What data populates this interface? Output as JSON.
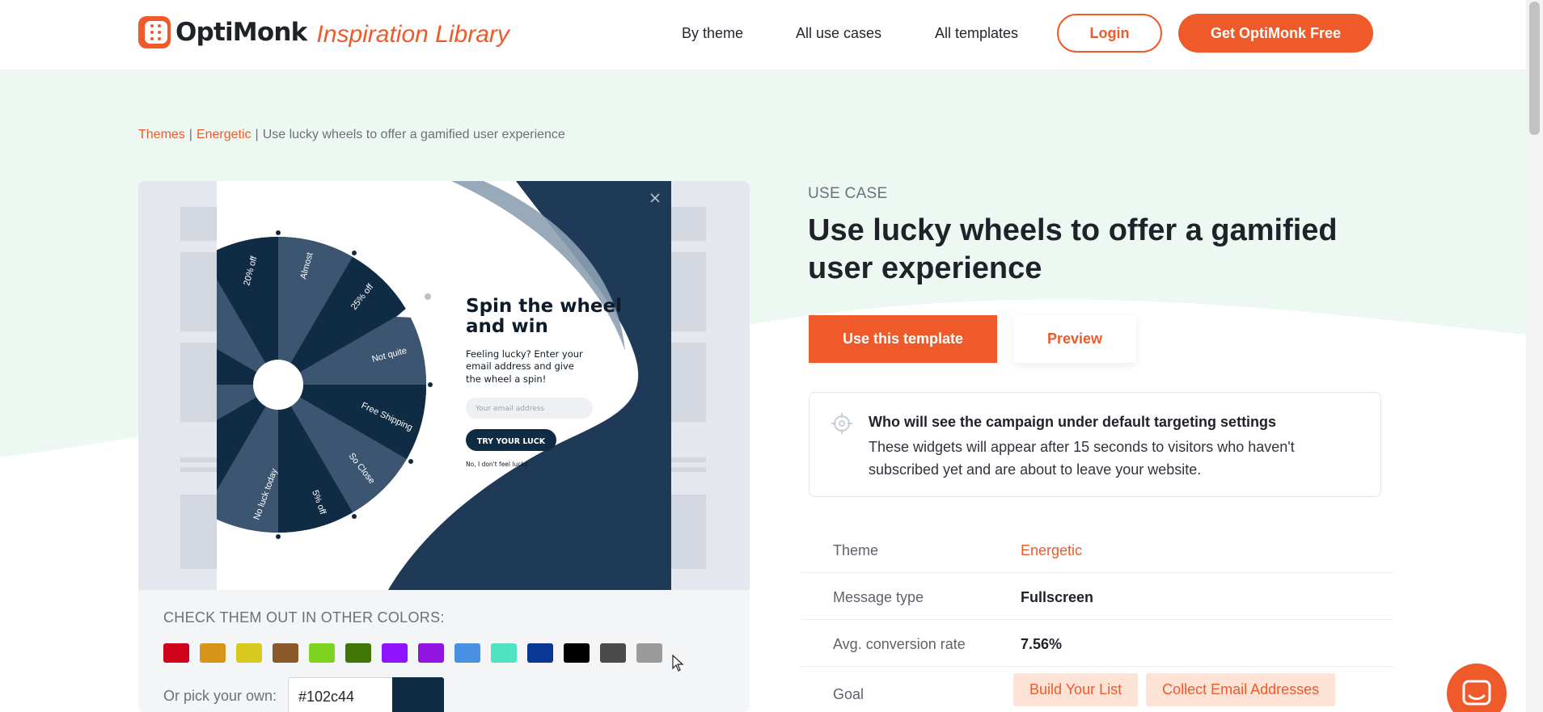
{
  "header": {
    "logo_text": "OptiMonk",
    "logo_subtitle": "Inspiration Library",
    "nav": [
      {
        "label": "By theme"
      },
      {
        "label": "All use cases"
      },
      {
        "label": "All templates"
      }
    ],
    "login_label": "Login",
    "cta_label": "Get OptiMonk Free"
  },
  "breadcrumb": {
    "items": [
      "Themes",
      "Energetic"
    ],
    "current": "Use lucky wheels to offer a gamified user experience",
    "separator": "|"
  },
  "preview": {
    "popup": {
      "headline_line1": "Spin the wheel",
      "headline_line2": "and win",
      "body_line1": "Feeling lucky? Enter your",
      "body_line2": "email address and give",
      "body_line3": "the wheel a spin!",
      "email_placeholder": "Your email address",
      "button_label": "TRY YOUR LUCK",
      "decline_label": "No, I don't feel lucky",
      "wheel_labels": [
        "20% off",
        "Almost",
        "25% off",
        "Not quite",
        "Free Shipping",
        "So Close",
        "5% off",
        "No luck today"
      ]
    },
    "colors_title": "CHECK THEM OUT IN OTHER COLORS:",
    "swatches": [
      "#d0021b",
      "#d8951a",
      "#d7ca1c",
      "#8b5a2b",
      "#7ed321",
      "#417505",
      "#9013fe",
      "#9013de",
      "#4a90e2",
      "#50e3c2",
      "#0a3696",
      "#000000",
      "#4a4a4a",
      "#9b9b9b"
    ],
    "pick_label": "Or pick your own:",
    "hex_value": "#102c44",
    "selected_color": "#102c44"
  },
  "details": {
    "eyebrow": "USE CASE",
    "title": "Use lucky wheels to offer a gamified user experience",
    "use_template_label": "Use this template",
    "preview_label": "Preview",
    "targeting_title": "Who will see the campaign under default targeting settings",
    "targeting_text": "These widgets will appear after 15 seconds to visitors who haven't subscribed yet and are about to leave your website.",
    "rows": [
      {
        "label": "Theme",
        "value": "Energetic"
      },
      {
        "label": "Message type",
        "value": "Fullscreen"
      },
      {
        "label": "Avg. conversion rate",
        "value": "7.56%"
      },
      {
        "label": "Goal"
      }
    ],
    "goal_tags": [
      "Build Your List",
      "Collect Email Addresses"
    ]
  },
  "colors": {
    "accent": "#ee5a2a",
    "navy": "#102c44",
    "mint_bg": "#eef8f3"
  }
}
